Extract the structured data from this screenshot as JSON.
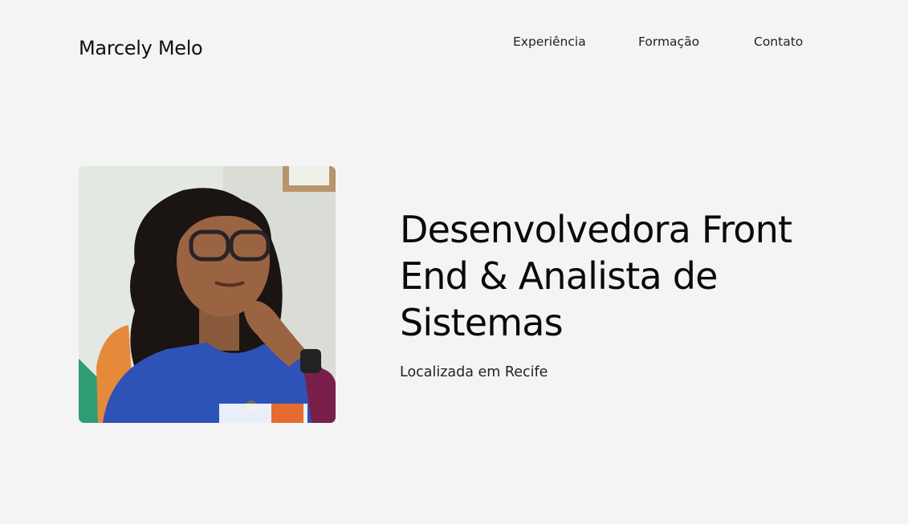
{
  "header": {
    "logo_text": "Marcely Melo",
    "nav": [
      {
        "label": "Experiência"
      },
      {
        "label": "Formação"
      },
      {
        "label": "Contato"
      }
    ]
  },
  "hero": {
    "headline": "Desenvolvedora Front End & Analista de Sistemas",
    "location": "Localizada em Recife",
    "photo_alt": "Marcely Melo"
  },
  "colors": {
    "background": "#f4f4f4",
    "text": "#0a0a0a"
  }
}
